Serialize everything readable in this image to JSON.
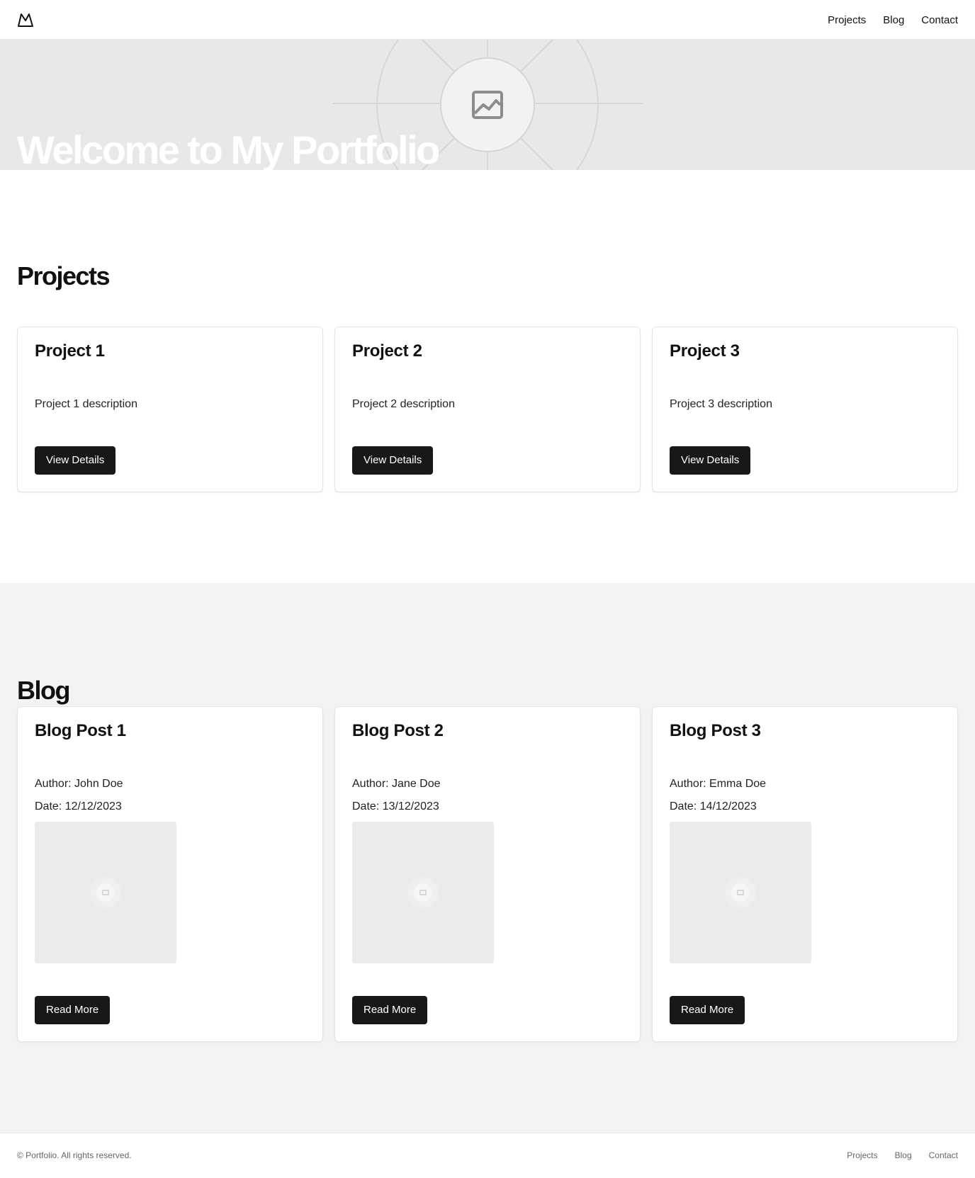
{
  "header": {
    "logo_icon": "mountain-logo-icon",
    "nav": [
      "Projects",
      "Blog",
      "Contact"
    ]
  },
  "hero": {
    "title": "Welcome to My Portfolio",
    "image_icon": "image-placeholder-icon"
  },
  "projects": {
    "title": "Projects",
    "cards": [
      {
        "title": "Project 1",
        "description": "Project 1 description",
        "button": "View Details"
      },
      {
        "title": "Project 2",
        "description": "Project 2 description",
        "button": "View Details"
      },
      {
        "title": "Project 3",
        "description": "Project 3 description",
        "button": "View Details"
      }
    ]
  },
  "blog": {
    "title": "Blog",
    "posts": [
      {
        "title": "Blog Post 1",
        "author": "Author: John Doe",
        "date": "Date: 12/12/2023",
        "button": "Read More"
      },
      {
        "title": "Blog Post 2",
        "author": "Author: Jane Doe",
        "date": "Date: 13/12/2023",
        "button": "Read More"
      },
      {
        "title": "Blog Post 3",
        "author": "Author: Emma Doe",
        "date": "Date: 14/12/2023",
        "button": "Read More"
      }
    ]
  },
  "footer": {
    "copyright": "© Portfolio. All rights reserved.",
    "nav": [
      "Projects",
      "Blog",
      "Contact"
    ]
  },
  "colors": {
    "button_bg": "#18181b",
    "hero_bg": "#e8e8e8",
    "blog_bg": "#f2f3f5"
  }
}
